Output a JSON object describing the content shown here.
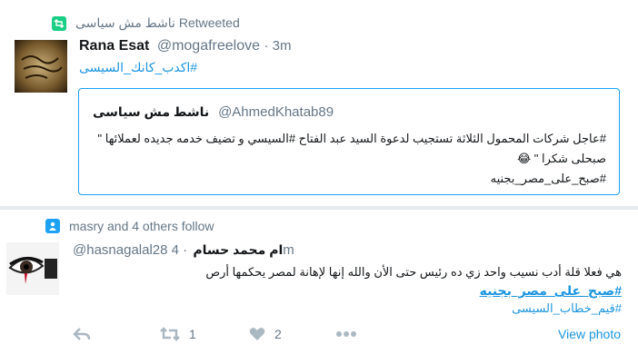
{
  "tweet1": {
    "context_text": "ناشط مش سياسى Retweeted",
    "author_name": "Rana Esat",
    "author_handle": "@mogafreelove",
    "time": "· 3m",
    "hashtag": "#اكدب_كانك_السيسى",
    "quote": {
      "author_name": "ناشط مش سياسى",
      "author_handle": "@AhmedKhatab89",
      "line1": "#عاجل شركات المحمول الثلاثة تستجيب لدعوة السيد عبد الفتاح #السيسي و تضيف خدمه جديده لعملائها \"",
      "line2": "صبحلى شكرا \" 😂",
      "hashtag": "#صبح_على_مصر_بجنيه"
    }
  },
  "tweet2": {
    "context_text": "masry and 4 others follow",
    "author_name": "ام محمد حسام",
    "author_handle": "@hasnagalal28",
    "time": "· 4m",
    "text": "هي فعلا قلة أدب نسيب واحد زي ده رئيس حتى الأن والله إنها لإهانة لمصر يحكمها أرص",
    "hashtag1": "#صبح_على_مصر_بجنيه",
    "hashtag2": "#قيم_خطاب_السيسى",
    "actions": {
      "retweet_count": "1",
      "like_count": "2",
      "view_photo": "View photo"
    }
  },
  "colors": {
    "link": "#1b95e0",
    "retweet_green": "#19cf86",
    "follow_blue": "#1da1f2",
    "muted": "#657786",
    "action_gray": "#aab8c2"
  }
}
